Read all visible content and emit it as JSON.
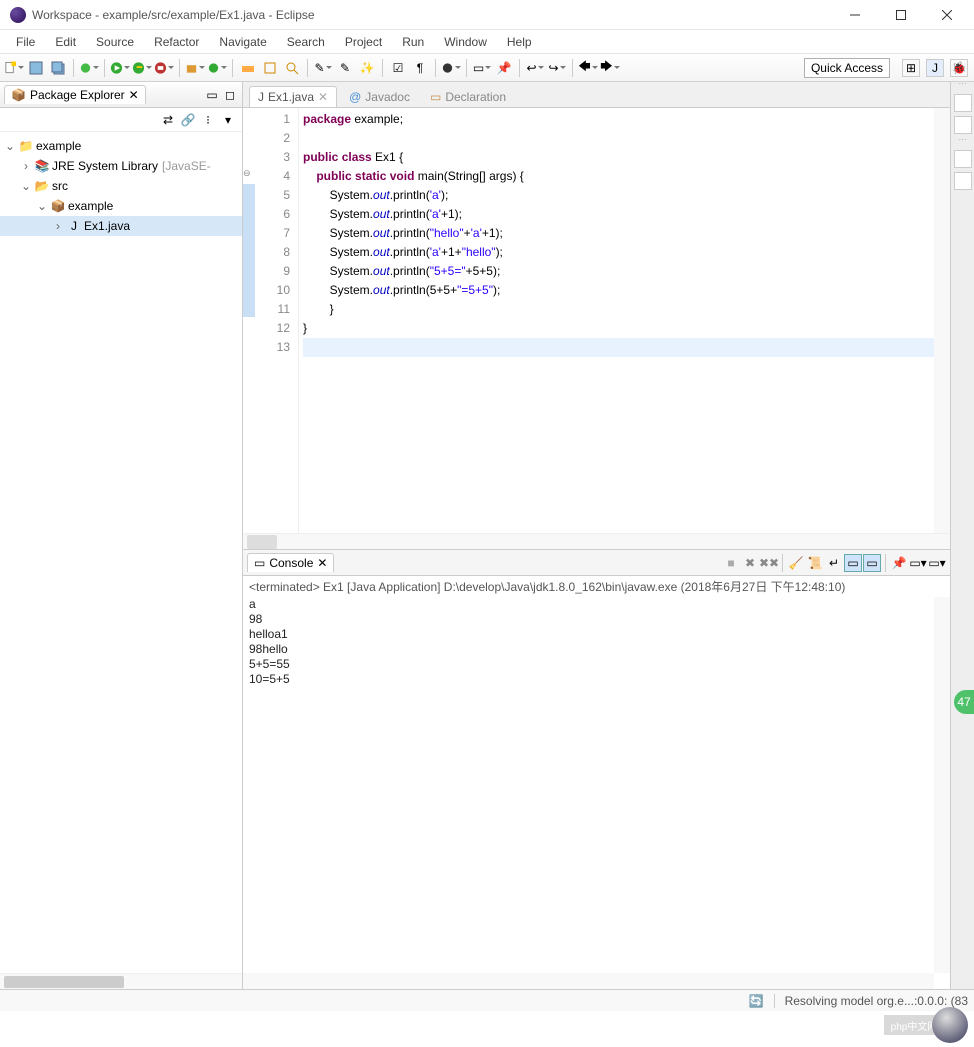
{
  "window": {
    "title": "Workspace - example/src/example/Ex1.java - Eclipse"
  },
  "menu": [
    "File",
    "Edit",
    "Source",
    "Refactor",
    "Navigate",
    "Search",
    "Project",
    "Run",
    "Window",
    "Help"
  ],
  "quick_access": "Quick Access",
  "package_explorer": {
    "title": "Package Explorer",
    "tree": {
      "project": "example",
      "jre": "JRE System Library",
      "jre_decor": "[JavaSE-",
      "src": "src",
      "pkg": "example",
      "file": "Ex1.java"
    }
  },
  "editor_tabs": {
    "active": "Ex1.java",
    "javadoc": "Javadoc",
    "declaration": "Declaration"
  },
  "code": {
    "lines": [
      {
        "n": "1",
        "t": [
          [
            "kw",
            "package"
          ],
          [
            "",
            " example;"
          ]
        ]
      },
      {
        "n": "2",
        "t": [
          [
            "",
            ""
          ]
        ]
      },
      {
        "n": "3",
        "t": [
          [
            "kw",
            "public"
          ],
          [
            "",
            " "
          ],
          [
            "kw",
            "class"
          ],
          [
            "",
            " Ex1 {"
          ]
        ]
      },
      {
        "n": "4",
        "mark": "circle",
        "t": [
          [
            "",
            "    "
          ],
          [
            "kw",
            "public"
          ],
          [
            "",
            " "
          ],
          [
            "kw",
            "static"
          ],
          [
            "",
            " "
          ],
          [
            "kw",
            "void"
          ],
          [
            "",
            " main(String[] args) {"
          ]
        ]
      },
      {
        "n": "5",
        "mark": "blue",
        "t": [
          [
            "",
            "        System."
          ],
          [
            "fld",
            "out"
          ],
          [
            "",
            ".println("
          ],
          [
            "str",
            "'a'"
          ],
          [
            "",
            ");"
          ]
        ]
      },
      {
        "n": "6",
        "mark": "blue",
        "t": [
          [
            "",
            "        System."
          ],
          [
            "fld",
            "out"
          ],
          [
            "",
            ".println("
          ],
          [
            "str",
            "'a'"
          ],
          [
            "",
            "+1);"
          ]
        ]
      },
      {
        "n": "7",
        "mark": "blue",
        "t": [
          [
            "",
            "        System."
          ],
          [
            "fld",
            "out"
          ],
          [
            "",
            ".println("
          ],
          [
            "str",
            "\"hello\""
          ],
          [
            "",
            "+"
          ],
          [
            "str",
            "'a'"
          ],
          [
            "",
            "+1);"
          ]
        ]
      },
      {
        "n": "8",
        "mark": "blue",
        "t": [
          [
            "",
            "        System."
          ],
          [
            "fld",
            "out"
          ],
          [
            "",
            ".println("
          ],
          [
            "str",
            "'a'"
          ],
          [
            "",
            "+1+"
          ],
          [
            "str",
            "\"hello\""
          ],
          [
            "",
            ");"
          ]
        ]
      },
      {
        "n": "9",
        "mark": "blue",
        "t": [
          [
            "",
            "        System."
          ],
          [
            "fld",
            "out"
          ],
          [
            "",
            ".println("
          ],
          [
            "str",
            "\"5+5=\""
          ],
          [
            "",
            "+5+5);"
          ]
        ]
      },
      {
        "n": "10",
        "mark": "blue",
        "t": [
          [
            "",
            "        System."
          ],
          [
            "fld",
            "out"
          ],
          [
            "",
            ".println(5+5+"
          ],
          [
            "str",
            "\"=5+5\""
          ],
          [
            "",
            ");"
          ]
        ]
      },
      {
        "n": "11",
        "mark": "blue",
        "t": [
          [
            "",
            "        }"
          ]
        ]
      },
      {
        "n": "12",
        "t": [
          [
            "",
            "}"
          ]
        ]
      },
      {
        "n": "13",
        "t": [
          [
            "",
            ""
          ]
        ],
        "current": true
      }
    ]
  },
  "console": {
    "title": "Console",
    "status": "<terminated> Ex1 [Java Application] D:\\develop\\Java\\jdk1.8.0_162\\bin\\javaw.exe (2018年6月27日 下午12:48:10)",
    "output": "a\n98\nhelloa1\n98hello\n5+5=55\n10=5+5"
  },
  "statusbar": {
    "msg": "Resolving model org.e...:0.0.0: (83",
    "badge": "47"
  },
  "watermark": "php中文网"
}
